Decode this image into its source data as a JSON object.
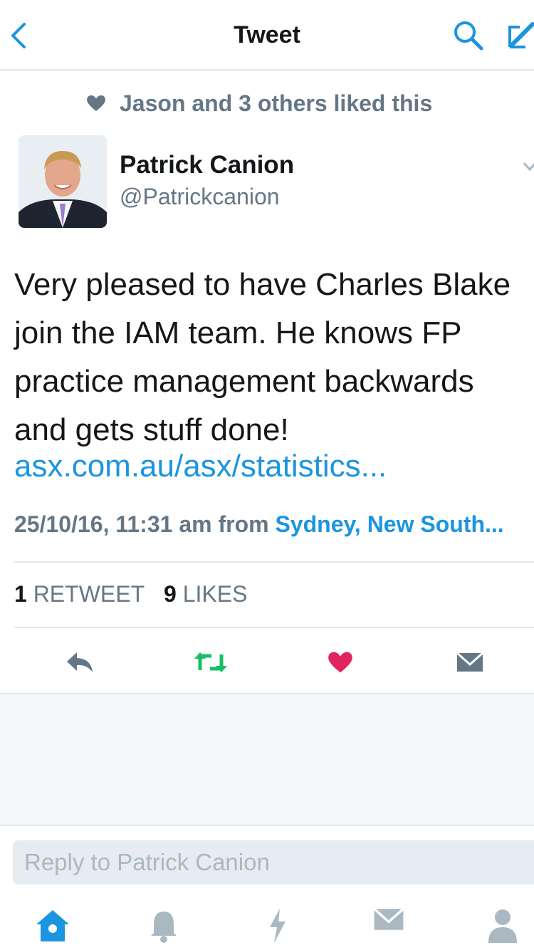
{
  "nav": {
    "title": "Tweet"
  },
  "social_context": {
    "text": "Jason and 3 others liked this"
  },
  "author": {
    "name": "Patrick Canion",
    "handle": "@Patrickcanion"
  },
  "tweet": {
    "text": "Very pleased to have Charles Blake join the IAM team. He knows FP practice management backwards and gets stuff done!",
    "link": "asx.com.au/asx/statistics...",
    "timestamp": "25/10/16, 11:31 am from ",
    "location": "Sydney, New South..."
  },
  "stats": {
    "retweets_count": "1",
    "retweets_label": "RETWEET",
    "likes_count": "9",
    "likes_label": "LIKES"
  },
  "reply": {
    "placeholder": "Reply to Patrick Canion"
  },
  "colors": {
    "accent": "#1b95e0",
    "retweet": "#17bf63",
    "like": "#e0245e",
    "muted": "#657786"
  },
  "icons": [
    "back-icon",
    "search-icon",
    "compose-icon",
    "heart-icon",
    "caret-down-icon",
    "reply-icon",
    "retweet-icon",
    "like-icon",
    "direct-message-icon",
    "home-icon",
    "notifications-icon",
    "moments-icon",
    "messages-icon",
    "profile-icon"
  ]
}
